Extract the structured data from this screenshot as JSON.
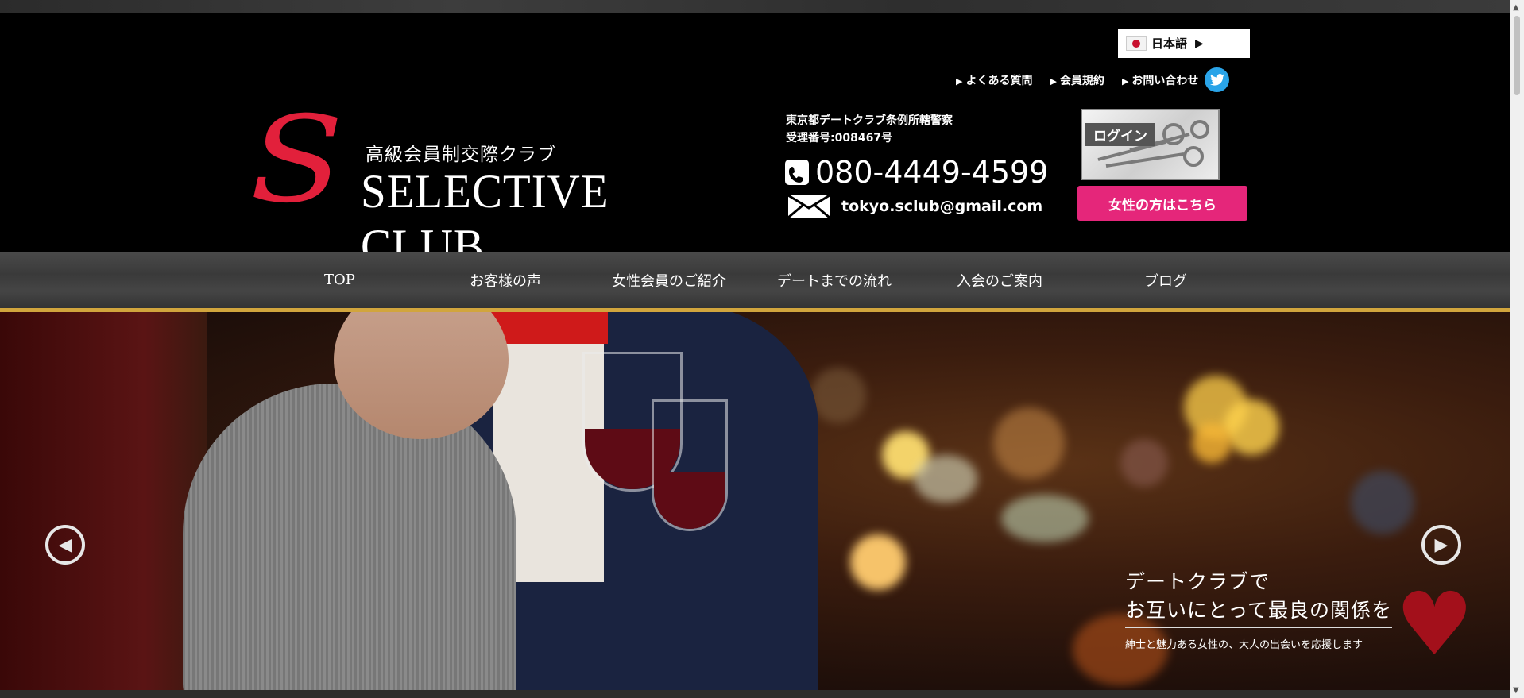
{
  "header": {
    "logo_letter": "S",
    "tagline": "高級会員制交際クラブ",
    "club_name": "SELECTIVE CLUB",
    "language": "日本語",
    "top_links": [
      "よくある質問",
      "会員規約",
      "お問い合わせ"
    ],
    "license_line1": "東京都デートクラブ条例所轄警察",
    "license_line2": "受理番号:008467号",
    "phone": "080-4449-4599",
    "email": "tokyo.sclub@gmail.com",
    "login_label": "ログイン",
    "women_button": "女性の方はこちら"
  },
  "nav": {
    "items": [
      "TOP",
      "お客様の声",
      "女性会員のご紹介",
      "デートまでの流れ",
      "入会のご案内",
      "ブログ"
    ]
  },
  "hero": {
    "caption_line1": "デートクラブで",
    "caption_line2": "お互いにとって最良の関係を",
    "caption_line3": "紳士と魅力ある女性の、大人の出会いを応援します"
  },
  "colors": {
    "logo_red": "#e2203b",
    "nav_border_gold": "#d1a53d",
    "women_button_pink": "#e5267a",
    "twitter_blue": "#2aa4e8"
  },
  "icons": [
    "flag-icon",
    "twitter-icon",
    "phone-icon",
    "mail-icon",
    "prev-arrow-icon",
    "next-arrow-icon",
    "heart-icon"
  ]
}
